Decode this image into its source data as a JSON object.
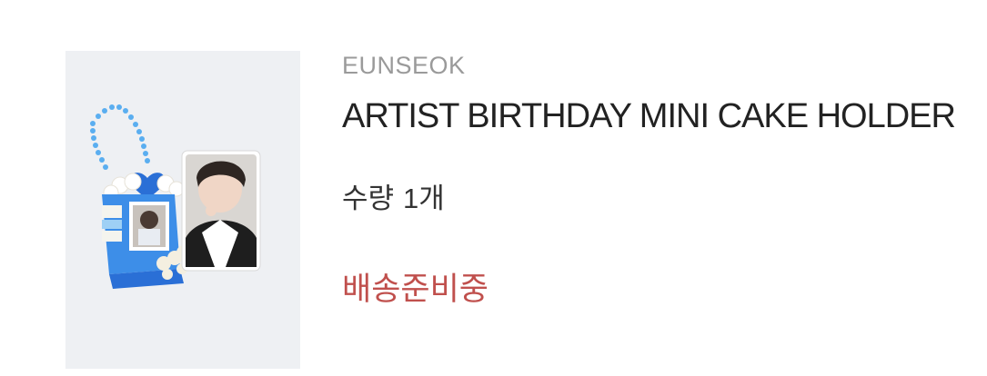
{
  "order_item": {
    "artist": "EUNSEOK",
    "product_name": "ARTIST BIRTHDAY MINI CAKE HOLDER",
    "quantity_label": "수량",
    "quantity_value": "1개",
    "status": "배송준비중",
    "status_color": "#c0504d",
    "thumbnail_bg": "#eef0f3"
  }
}
